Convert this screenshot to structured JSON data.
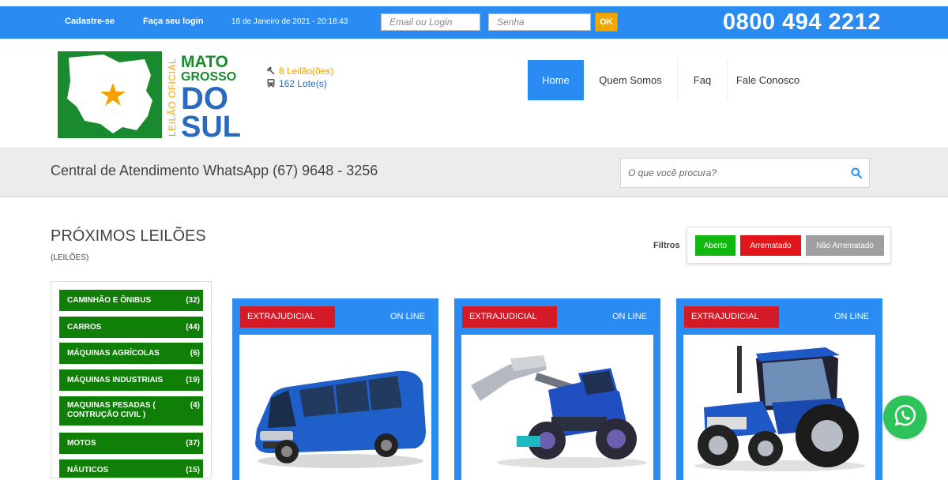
{
  "topbar": {
    "register_label": "Cadastre-se",
    "login_label": "Faça seu login",
    "datetime": "18 de Janeiro de 2021 - 20:18:43",
    "email_placeholder": "Email ou Login",
    "password_placeholder": "Senha",
    "ok_label": "OK",
    "phone": "0800 494 2212"
  },
  "logo": {
    "line1": "MATO",
    "line2": "GROSSO",
    "line3": "DO",
    "line4": "SUL",
    "side_text": "LEILÃO OFICIAL"
  },
  "stats": {
    "auctions": "8 Leilão(ões)",
    "lots": "162 Lote(s)"
  },
  "nav": {
    "home": "Home",
    "about": "Quem Somos",
    "faq": "Faq",
    "contact": "Fale Conosco"
  },
  "band": {
    "central": "Central de Atendimento WhatsApp (67) 9648 - 3256",
    "search_placeholder": "O que você procura?"
  },
  "section": {
    "title": "PRÓXIMOS LEILÕES",
    "subtitle": "(LEILÕES)",
    "filters_label": "Filtros",
    "filter_open": "Aberto",
    "filter_sold": "Arrematado",
    "filter_unsold": "Não Arrematado"
  },
  "categories": [
    {
      "name": "CAMINHÃO E ÔNIBUS",
      "count": "(32)"
    },
    {
      "name": "CARROS",
      "count": "(44)"
    },
    {
      "name": "MÁQUINAS AGRÍCOLAS",
      "count": "(6)"
    },
    {
      "name": "MÁQUINAS INDUSTRIAIS",
      "count": "(19)"
    },
    {
      "name": "MAQUINAS PESADAS ( CONTRUÇÃO CIVIL )",
      "count": "(4)"
    },
    {
      "name": "MOTOS",
      "count": "(37)"
    },
    {
      "name": "NÁUTICOS",
      "count": "(15)"
    }
  ],
  "cards": [
    {
      "tag": "EXTRAJUDICIAL",
      "status": "ON LINE",
      "image": "minibus-image"
    },
    {
      "tag": "EXTRAJUDICIAL",
      "status": "ON LINE",
      "image": "loader-machine-image"
    },
    {
      "tag": "EXTRAJUDICIAL",
      "status": "ON LINE",
      "image": "tractor-image"
    }
  ],
  "colors": {
    "primary_blue": "#2a8bf2",
    "category_green": "#0f7f08",
    "tag_red": "#d41a27",
    "ok_orange": "#f0a800",
    "whatsapp_green": "#2ec35a"
  }
}
